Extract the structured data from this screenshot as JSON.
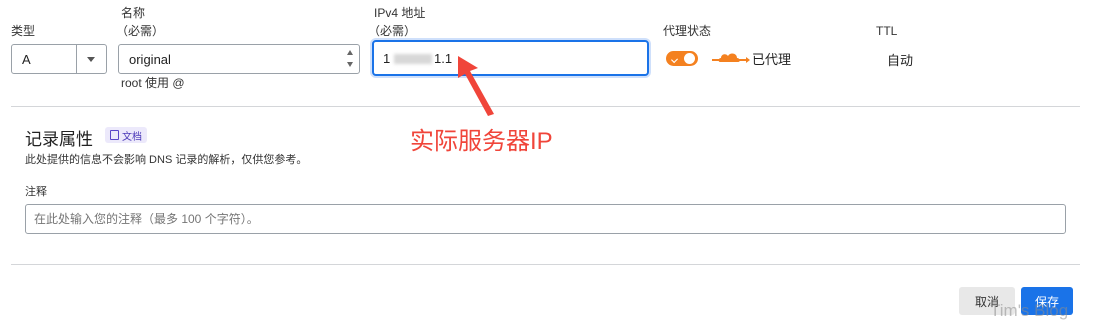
{
  "record": {
    "type_label": "类型",
    "type_value": "A",
    "name_label": "名称",
    "name_required": "（必需）",
    "name_value": "original",
    "name_hint": "root 使用 @",
    "ipv4_label": "IPv4 地址",
    "ipv4_required": "（必需）",
    "ipv4_value_left": "1",
    "ipv4_value_right": "1.1",
    "proxy_label": "代理状态",
    "proxy_status": "已代理",
    "ttl_label": "TTL",
    "ttl_value": "自动"
  },
  "annotation": {
    "text": "实际服务器IP",
    "color": "#f0453a"
  },
  "attributes": {
    "title": "记录属性",
    "docs_link": "文档",
    "description": "此处提供的信息不会影响 DNS 记录的解析，仅供您参考。",
    "comment_label": "注释",
    "comment_placeholder": "在此处输入您的注释（最多 100 个字符）。"
  },
  "actions": {
    "cancel": "取消",
    "save": "保存"
  },
  "watermark": "Tim's Blog",
  "colors": {
    "accent": "#1a73e8",
    "toggle": "#f48120",
    "cloud": "#f48120"
  }
}
